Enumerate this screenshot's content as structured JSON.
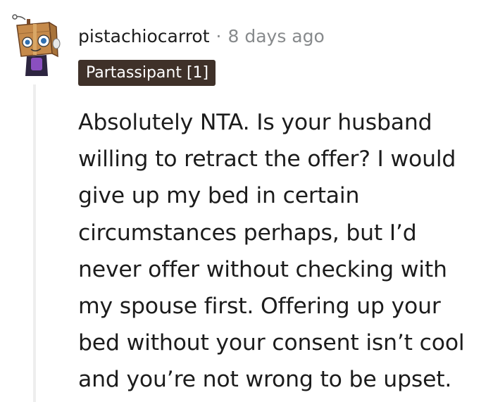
{
  "comment": {
    "author": "pistachiocarrot",
    "separator": "·",
    "age": "8 days ago",
    "flair": "Partassipant [1]",
    "body_lines": [
      "Absolutely NTA. Is your husband",
      "willing to retract the offer? I would",
      "give up my bed in certain",
      "circumstances perhaps, but I’d",
      "never offer without checking with",
      "my spouse first. Offering up your",
      "bed without your consent isn’t cool",
      "and you’re not wrong to be upset."
    ]
  },
  "colors": {
    "flair_background": "#3f3129",
    "flair_text": "#ffffff",
    "body_text": "#1c1c1c",
    "meta_text": "#878a8c",
    "thread_line": "#eeeeee"
  },
  "icons": {
    "avatar": "snoo-avatar-cardboard-box-costume-icon"
  }
}
